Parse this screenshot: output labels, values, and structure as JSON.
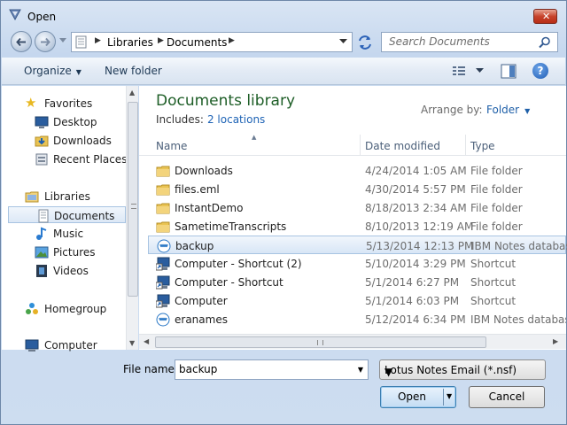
{
  "window": {
    "title": "Open"
  },
  "address": {
    "crumbs": [
      "Libraries",
      "Documents"
    ]
  },
  "search": {
    "placeholder": "Search Documents"
  },
  "toolbar": {
    "organize": "Organize",
    "new_folder": "New folder"
  },
  "navpane": {
    "favorites": {
      "label": "Favorites",
      "items": [
        "Desktop",
        "Downloads",
        "Recent Places"
      ]
    },
    "libraries": {
      "label": "Libraries",
      "items": [
        "Documents",
        "Music",
        "Pictures",
        "Videos"
      ]
    },
    "homegroup": "Homegroup",
    "computer": "Computer"
  },
  "library": {
    "title": "Documents library",
    "includes_label": "Includes:",
    "includes_link": "2 locations",
    "arrange_label": "Arrange by:",
    "arrange_value": "Folder"
  },
  "columns": {
    "name": "Name",
    "date": "Date modified",
    "type": "Type"
  },
  "files": [
    {
      "name": "Downloads",
      "date": "4/24/2014 1:05 AM",
      "type": "File folder",
      "icon": "folder-icon"
    },
    {
      "name": "files.eml",
      "date": "4/30/2014 5:57 PM",
      "type": "File folder",
      "icon": "folder-icon"
    },
    {
      "name": "InstantDemo",
      "date": "8/18/2013 2:34 AM",
      "type": "File folder",
      "icon": "folder-icon"
    },
    {
      "name": "SametimeTranscripts",
      "date": "8/10/2013 12:19 AM",
      "type": "File folder",
      "icon": "folder-icon"
    },
    {
      "name": "backup",
      "date": "5/13/2014 12:13 PM",
      "type": "IBM Notes database",
      "icon": "notes-db-icon",
      "selected": true
    },
    {
      "name": "Computer - Shortcut (2)",
      "date": "5/10/2014 3:29 PM",
      "type": "Shortcut",
      "icon": "computer-shortcut-icon"
    },
    {
      "name": "Computer - Shortcut",
      "date": "5/1/2014 6:27 PM",
      "type": "Shortcut",
      "icon": "computer-shortcut-icon"
    },
    {
      "name": "Computer",
      "date": "5/1/2014 6:03 PM",
      "type": "Shortcut",
      "icon": "computer-shortcut-icon"
    },
    {
      "name": "eranames",
      "date": "5/12/2014 6:34 PM",
      "type": "IBM Notes database",
      "icon": "notes-db-icon"
    }
  ],
  "filename": {
    "label": "File name:",
    "value": "backup"
  },
  "filetype": {
    "value": "Lotus Notes Email (*.nsf)"
  },
  "buttons": {
    "open": "Open",
    "cancel": "Cancel"
  },
  "colors": {
    "accent": "#1e63b5",
    "library_title": "#1e5e27",
    "selection": "#d8e6f6"
  }
}
